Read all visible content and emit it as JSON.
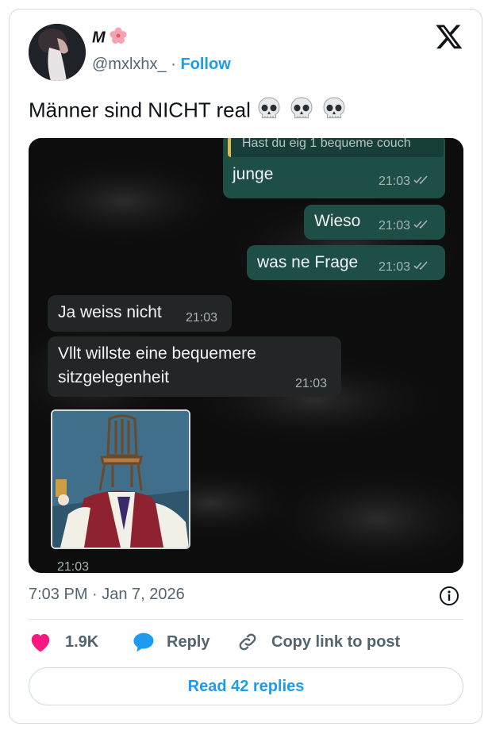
{
  "tweet": {
    "display_name": "M",
    "handle": "@mxlxhx_",
    "separator": " · ",
    "follow_label": "Follow",
    "text": "Männer sind NICHT real",
    "emojis": [
      "skull-icon",
      "skull-icon",
      "skull-icon"
    ],
    "timestamp": "7:03 PM · Jan 7, 2026"
  },
  "chat": {
    "quoted_text": "Hast du eig 1 bequeme couch",
    "messages": [
      {
        "dir": "out",
        "text": "junge",
        "time": "21:03"
      },
      {
        "dir": "out",
        "text": "Wieso",
        "time": "21:03"
      },
      {
        "dir": "out",
        "text": "was ne Frage",
        "time": "21:03"
      },
      {
        "dir": "in",
        "text": "Ja weiss nicht",
        "time": "21:03"
      },
      {
        "dir": "in",
        "text_line1": "Vllt willste eine bequemere",
        "text_line2": "sitzgelegenheit",
        "time": "21:03"
      },
      {
        "dir": "in",
        "type": "image",
        "time": "21:03"
      }
    ]
  },
  "actions": {
    "likes": "1.9K",
    "reply_label": "Reply",
    "copy_label": "Copy link to post",
    "read_replies": "Read 42 replies"
  },
  "colors": {
    "accent": "#1d9bf0",
    "heart": "#f91880",
    "bubble_out": "#1e4f47",
    "bubble_in": "#232626"
  }
}
